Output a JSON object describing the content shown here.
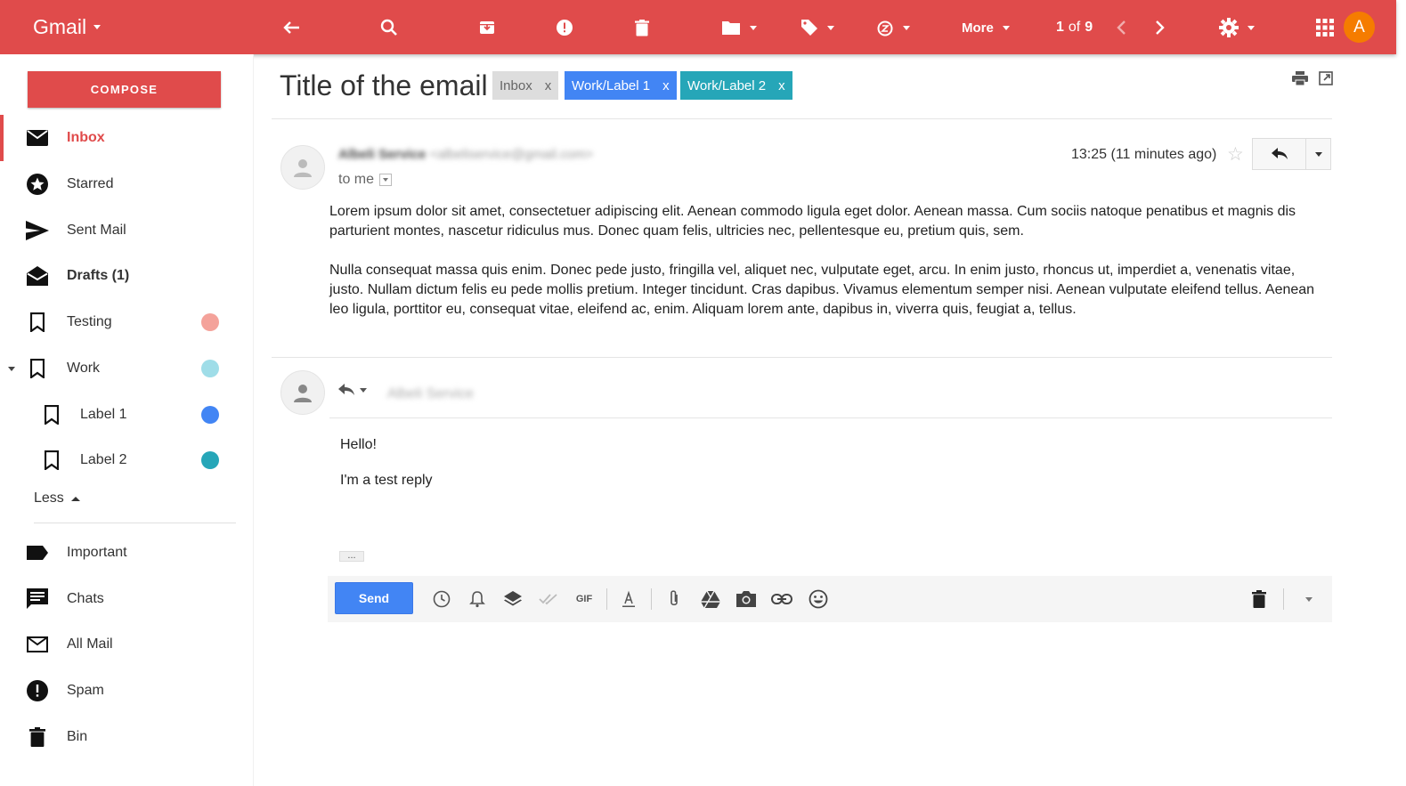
{
  "topbar": {
    "brand": "Gmail",
    "more_label": "More",
    "pager_current": "1",
    "pager_of": "of",
    "pager_total": "9",
    "avatar_letter": "A",
    "accent": "#e04b4b"
  },
  "sidebar": {
    "compose_label": "COMPOSE",
    "items": [
      {
        "label": "Inbox",
        "icon": "inbox-icon"
      },
      {
        "label": "Starred",
        "icon": "star-icon"
      },
      {
        "label": "Sent Mail",
        "icon": "send-icon"
      },
      {
        "label": "Drafts (1)",
        "icon": "drafts-icon"
      },
      {
        "label": "Testing",
        "icon": "label-icon",
        "color": "#f4a29a"
      },
      {
        "label": "Work",
        "icon": "label-icon",
        "color": "#9fdde8"
      },
      {
        "label": "Label 1",
        "icon": "label-icon",
        "color": "#4285f4"
      },
      {
        "label": "Label 2",
        "icon": "label-icon",
        "color": "#26a6b8"
      },
      {
        "label": "Important",
        "icon": "important-icon"
      },
      {
        "label": "Chats",
        "icon": "chat-icon"
      },
      {
        "label": "All Mail",
        "icon": "mail-icon"
      },
      {
        "label": "Spam",
        "icon": "spam-icon"
      },
      {
        "label": "Bin",
        "icon": "trash-icon"
      }
    ],
    "less_label": "Less"
  },
  "email": {
    "subject": "Title of the email",
    "tags": [
      {
        "label": "Inbox",
        "close": "x",
        "color": "#dddddd"
      },
      {
        "label": "Work/Label 1",
        "close": "x",
        "color": "#4285f4"
      },
      {
        "label": "Work/Label 2",
        "close": "x",
        "color": "#26a6b8"
      }
    ],
    "sender_name": "Albeli Service",
    "sender_email": "<albeliservice@gmail.com>",
    "to_label": "to me",
    "time": "13:25 (11 minutes ago)",
    "body": [
      "Lorem ipsum dolor sit amet, consectetuer adipiscing elit. Aenean commodo ligula eget dolor. Aenean massa. Cum sociis natoque penatibus et magnis dis parturient montes, nascetur ridiculus mus. Donec quam felis, ultricies nec, pellentesque eu, pretium quis, sem.",
      "Nulla consequat massa quis enim. Donec pede justo, fringilla vel, aliquet nec, vulputate eget, arcu. In enim justo, rhoncus ut, imperdiet a, venenatis vitae, justo. Nullam dictum felis eu pede mollis pretium. Integer tincidunt. Cras dapibus. Vivamus elementum semper nisi. Aenean vulputate eleifend tellus. Aenean leo ligula, porttitor eu, consequat vitae, eleifend ac, enim. Aliquam lorem ante, dapibus in, viverra quis, feugiat a, tellus."
    ]
  },
  "reply": {
    "recipient": "Albeli Service",
    "lines": [
      "Hello!",
      "I'm a test reply"
    ],
    "ellipsis": "...",
    "send_label": "Send",
    "gif_label": "GIF"
  }
}
